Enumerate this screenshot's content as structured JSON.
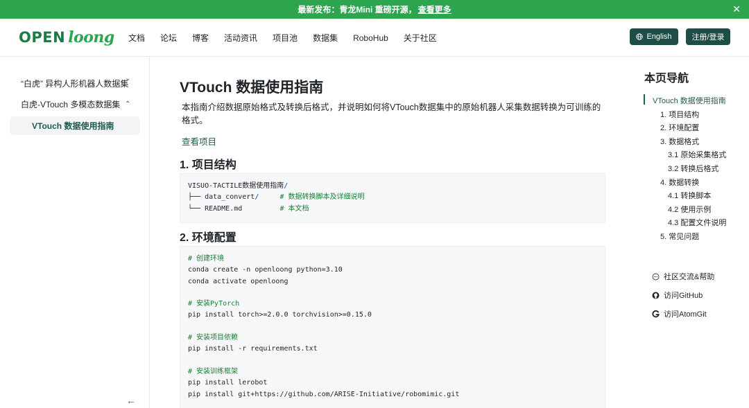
{
  "banner": {
    "text": "最新发布：青龙Mini 重磅开源，",
    "link": "查看更多",
    "close_glyph": "✕"
  },
  "header": {
    "logo_open": "OPEN",
    "logo_loong": "loong",
    "nav": [
      "文档",
      "论坛",
      "博客",
      "活动资讯",
      "项目池",
      "数据集",
      "RoboHub",
      "关于社区"
    ],
    "lang_button": "English",
    "login_button": "注册/登录"
  },
  "sidebar": {
    "items": [
      {
        "label": "“白虎” 异构人形机器人数据集",
        "chevron": "⌄"
      },
      {
        "label": "白虎-VTouch 多模态数据集",
        "chevron": "⌃"
      }
    ],
    "active_item": "VTouch 数据使用指南",
    "collapse_glyph": "←"
  },
  "main": {
    "title": "VTouch 数据使用指南",
    "intro": "本指南介绍数据原始格式及转换后格式，并说明如何将VTouch数据集中的原始机器人采集数据转换为可训练的格式。",
    "view_project": "查看项目",
    "section1_title": "1. 项目结构",
    "section2_title": "2. 环境配置",
    "code1": {
      "root": "VISUO-TACTILE数据使用指南",
      "root_suffix": "/",
      "line1_prefix": "├── data_convert",
      "line1_slash": "/",
      "line1_comment": "# 数据转换脚本及详细说明",
      "line2_prefix": "└── README.md",
      "line2_comment": "# 本文档"
    },
    "code2": [
      {
        "type": "comment",
        "text": "# 创建环境"
      },
      {
        "type": "code",
        "text": "conda create -n openloong python=3.10"
      },
      {
        "type": "code",
        "text": "conda activate openloong"
      },
      {
        "type": "blank",
        "text": ""
      },
      {
        "type": "comment",
        "text": "# 安装PyTorch"
      },
      {
        "type": "code",
        "text": "pip install torch>=2.0.0 torchvision>=0.15.0"
      },
      {
        "type": "blank",
        "text": ""
      },
      {
        "type": "comment",
        "text": "# 安装项目依赖"
      },
      {
        "type": "code",
        "text": "pip install -r requirements.txt"
      },
      {
        "type": "blank",
        "text": ""
      },
      {
        "type": "comment",
        "text": "# 安装训练框架"
      },
      {
        "type": "code",
        "text": "pip install lerobot"
      },
      {
        "type": "code",
        "text": "pip install git+https://github.com/ARISE-Initiative/robomimic.git"
      }
    ]
  },
  "toc": {
    "title": "本页导航",
    "items": [
      {
        "label": "VTouch 数据使用指南",
        "level": 0,
        "active": true
      },
      {
        "label": "1. 项目结构",
        "level": 1
      },
      {
        "label": "2. 环境配置",
        "level": 1
      },
      {
        "label": "3. 数据格式",
        "level": 1
      },
      {
        "label": "3.1 原始采集格式",
        "level": 2
      },
      {
        "label": "3.2 转换后格式",
        "level": 2
      },
      {
        "label": "4. 数据转换",
        "level": 1
      },
      {
        "label": "4.1 转换脚本",
        "level": 2
      },
      {
        "label": "4.2 使用示例",
        "level": 2
      },
      {
        "label": "4.3 配置文件说明",
        "level": 2
      },
      {
        "label": "5. 常见问题",
        "level": 1
      }
    ],
    "links": [
      {
        "label": "社区交流&帮助",
        "icon": "chat-icon"
      },
      {
        "label": "访问GitHub",
        "icon": "github-icon"
      },
      {
        "label": "访问AtomGit",
        "icon": "atomgit-icon"
      }
    ]
  },
  "colors": {
    "banner": "#2da44e",
    "button": "#1d4d45",
    "accent": "#1e5a4e",
    "comment": "#1a7f37"
  }
}
